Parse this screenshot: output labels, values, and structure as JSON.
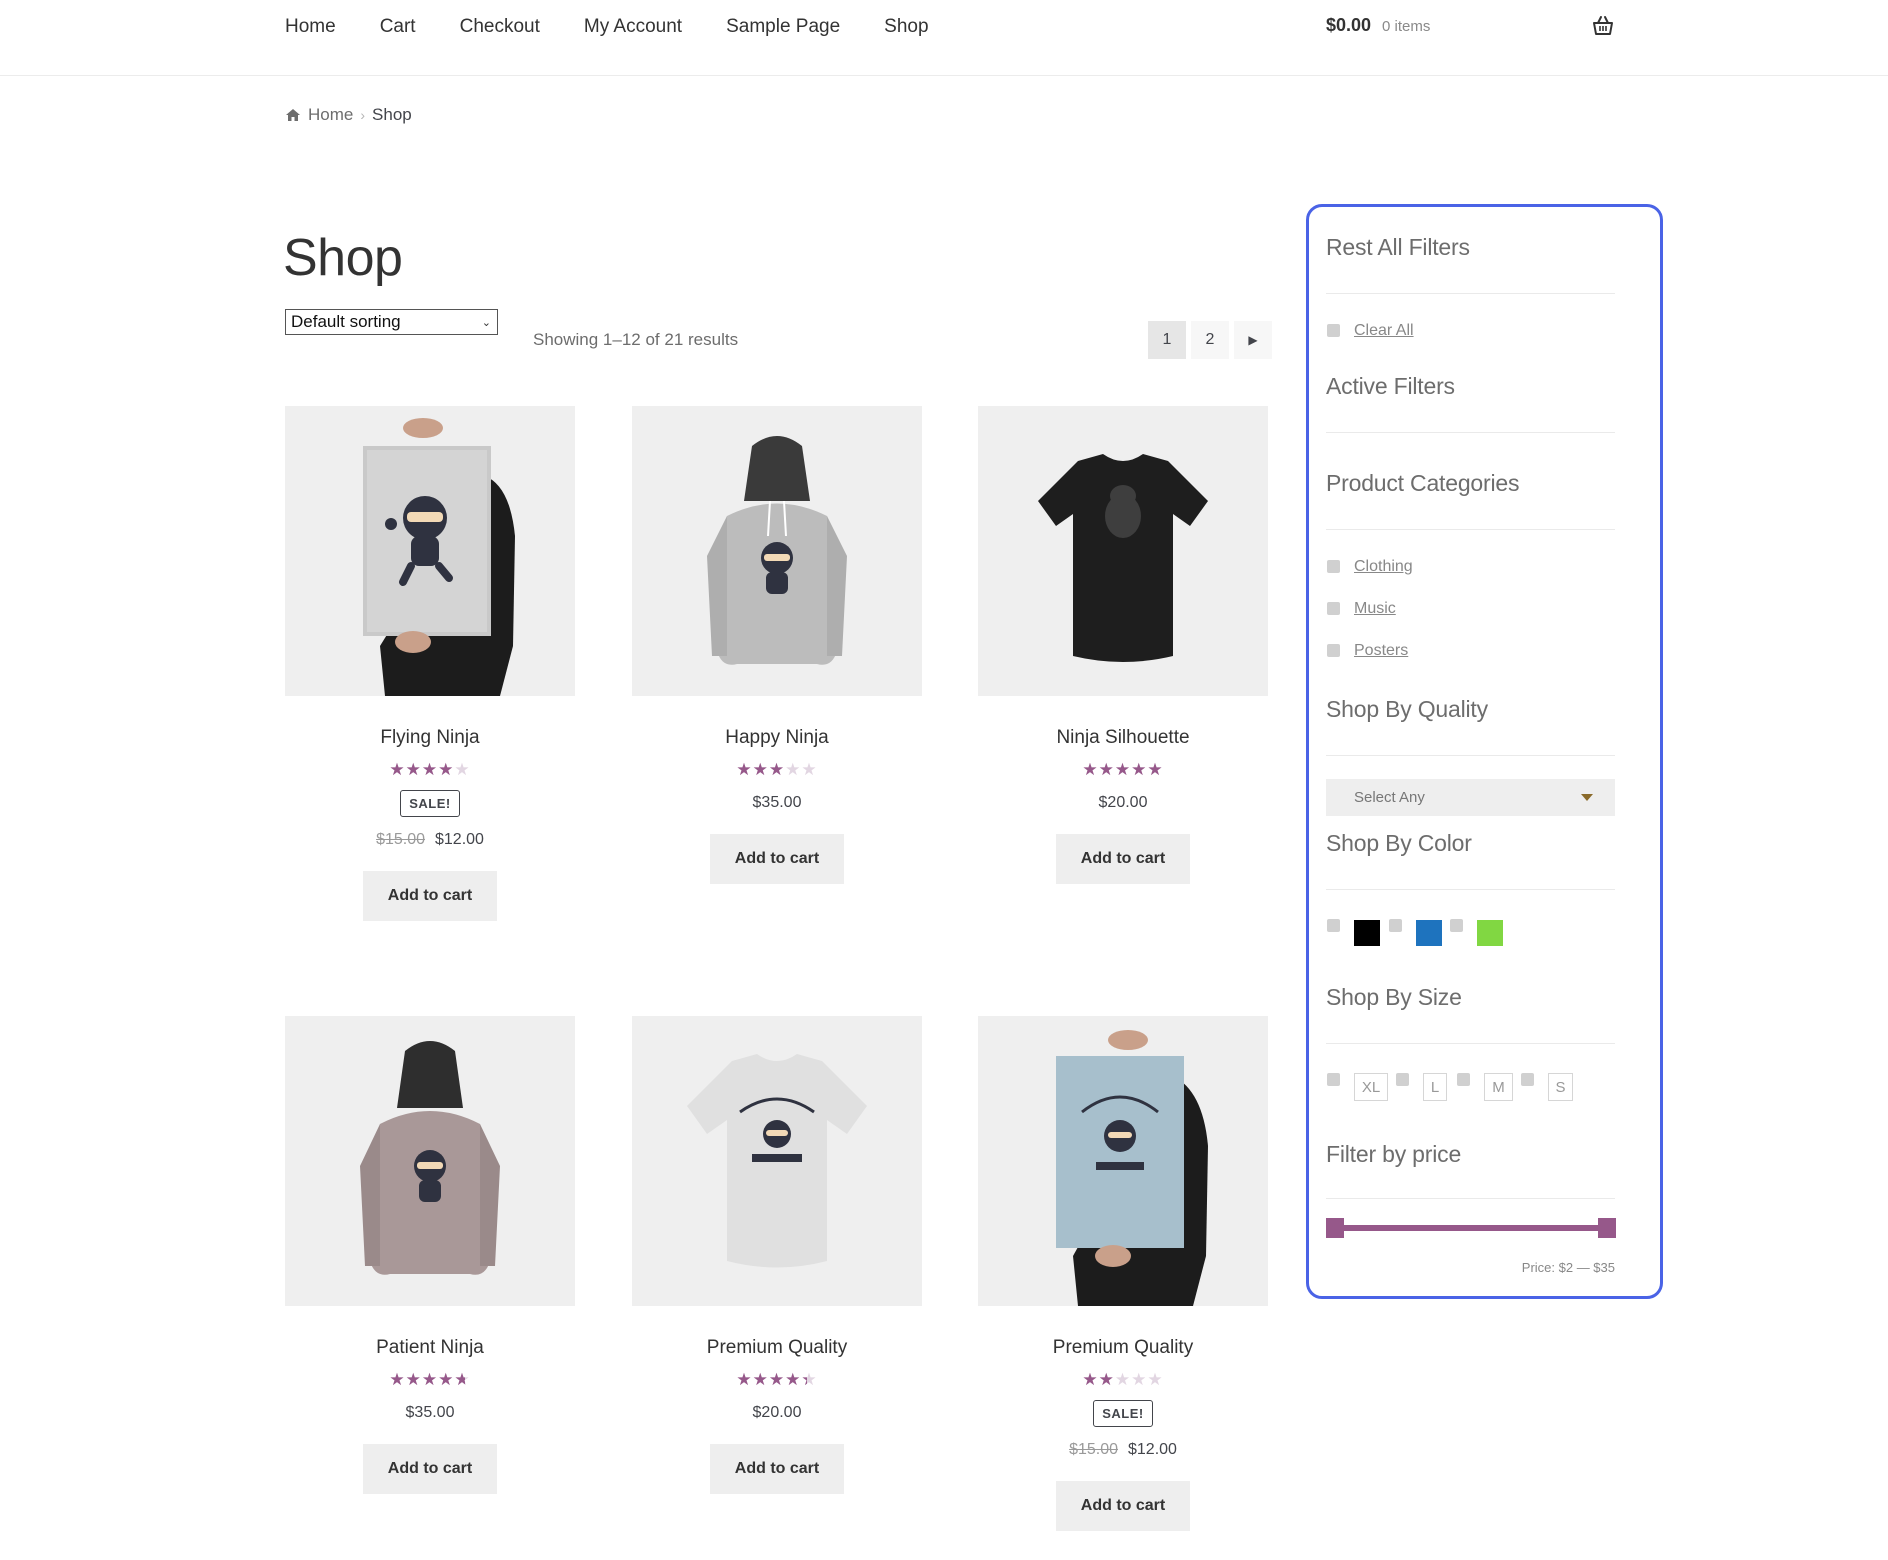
{
  "header": {
    "nav": [
      "Home",
      "Cart",
      "Checkout",
      "My Account",
      "Sample Page",
      "Shop"
    ],
    "cart_total": "$0.00",
    "cart_count": "0 items"
  },
  "breadcrumb": {
    "home": "Home",
    "current": "Shop"
  },
  "page": {
    "title": "Shop",
    "sorting": "Default sorting",
    "result_count": "Showing 1–12 of 21 results",
    "pagination": [
      "1",
      "2"
    ],
    "current_page": "1"
  },
  "products": [
    {
      "name": "Flying Ninja",
      "rating": 4,
      "sale": "SALE!",
      "old_price": "$15.00",
      "price": "$12.00",
      "button": "Add to cart"
    },
    {
      "name": "Happy Ninja",
      "rating": 3,
      "sale": "",
      "old_price": "",
      "price": "$35.00",
      "button": "Add to cart"
    },
    {
      "name": "Ninja Silhouette",
      "rating": 5,
      "sale": "",
      "old_price": "",
      "price": "$20.00",
      "button": "Add to cart"
    },
    {
      "name": "Patient Ninja",
      "rating": 4.67,
      "sale": "",
      "old_price": "",
      "price": "$35.00",
      "button": "Add to cart"
    },
    {
      "name": "Premium Quality",
      "rating": 4.33,
      "sale": "",
      "old_price": "",
      "price": "$20.00",
      "button": "Add to cart"
    },
    {
      "name": "Premium Quality",
      "rating": 2,
      "sale": "SALE!",
      "old_price": "$15.00",
      "price": "$12.00",
      "button": "Add to cart"
    }
  ],
  "sidebar": {
    "reset_title": "Rest All Filters",
    "clear_all": "Clear All",
    "active_title": "Active Filters",
    "categories_title": "Product Categories",
    "categories": [
      "Clothing",
      "Music",
      "Posters"
    ],
    "quality_title": "Shop By Quality",
    "quality_select": "Select Any",
    "color_title": "Shop By Color",
    "colors": [
      "#000000",
      "#1e73be",
      "#81d742"
    ],
    "size_title": "Shop By Size",
    "sizes": [
      "XL",
      "L",
      "M",
      "S"
    ],
    "price_title": "Filter by price",
    "price_range": "Price: $2 — $35",
    "price_min_fraction": 0,
    "price_max_fraction": 1
  },
  "colors": {
    "accent": "#96588a",
    "sidebar_border": "#4a63e6"
  }
}
